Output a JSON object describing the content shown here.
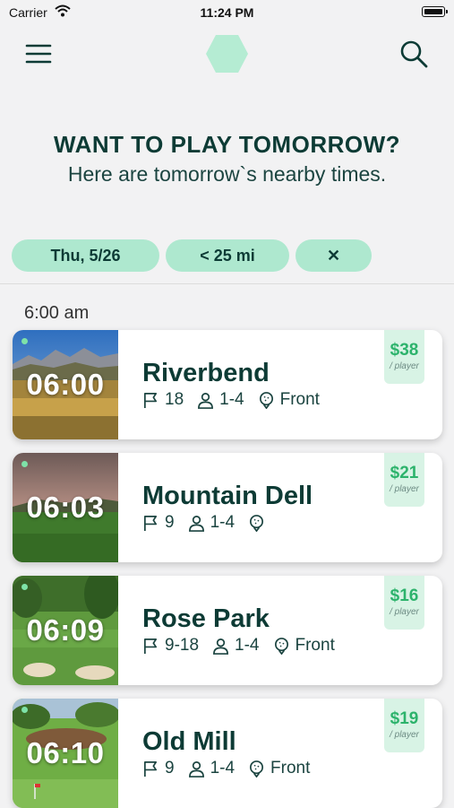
{
  "status_bar": {
    "carrier": "Carrier",
    "time": "11:24 PM"
  },
  "hero": {
    "title": "WANT TO PLAY TOMORROW?",
    "subtitle": "Here are tomorrow`s nearby times."
  },
  "filters": {
    "date": "Thu, 5/26",
    "distance": "< 25 mi",
    "clear": "✕"
  },
  "section_label": "6:00 am",
  "tee_times": [
    {
      "time": "06:00",
      "course": "Riverbend",
      "holes": "18",
      "players": "1-4",
      "tee": "Front",
      "price": "$38",
      "unit": "/ player"
    },
    {
      "time": "06:03",
      "course": "Mountain Dell",
      "holes": "9",
      "players": "1-4",
      "tee": "",
      "price": "$21",
      "unit": "/ player"
    },
    {
      "time": "06:09",
      "course": "Rose Park",
      "holes": "9-18",
      "players": "1-4",
      "tee": "Front",
      "price": "$16",
      "unit": "/ player"
    },
    {
      "time": "06:10",
      "course": "Old Mill",
      "holes": "9",
      "players": "1-4",
      "tee": "Front",
      "price": "$19",
      "unit": "/ player"
    }
  ],
  "colors": {
    "accent": "#aee8cf",
    "price_text": "#2db36c",
    "heading": "#0d3b35",
    "logo": "#b5ecd3"
  },
  "icons": {
    "menu": "hamburger-icon",
    "logo": "hexagon-logo-icon",
    "search": "search-icon",
    "holes": "flag-icon",
    "players": "person-icon",
    "tee": "golf-ball-tee-icon",
    "wifi": "wifi-icon",
    "battery": "battery-icon"
  }
}
